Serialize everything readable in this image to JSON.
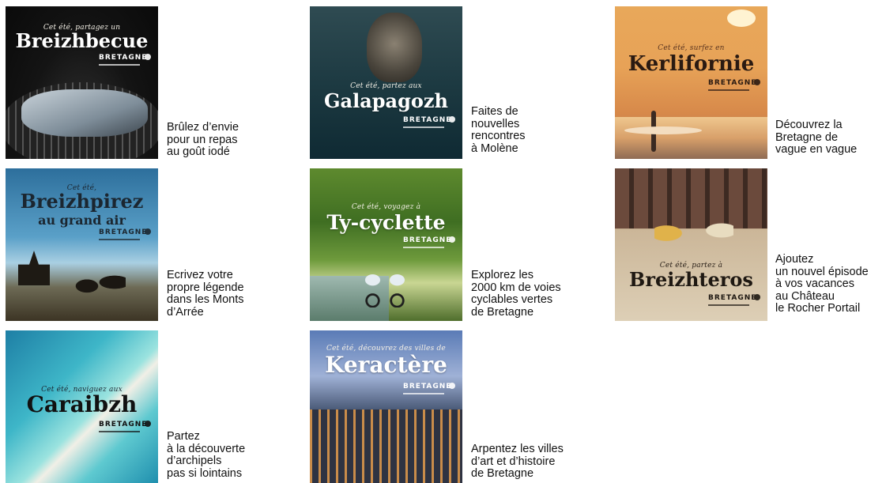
{
  "logo_text": "BRETAGNE",
  "posters": [
    {
      "intro": "Cet été, partagez un",
      "title": "Breizhbecue",
      "sub": "",
      "caption": "Brûlez d’envie\npour un repas\nau goût iodé"
    },
    {
      "intro": "Cet été, partez aux",
      "title": "Galapagozh",
      "sub": "",
      "caption": "Faites de\nnouvelles\nrencontres\nà Molène"
    },
    {
      "intro": "Cet été, surfez en",
      "title": "Kerlifornie",
      "sub": "",
      "caption": "Découvrez la\nBretagne de\nvague en vague"
    },
    {
      "intro": "Cet été,",
      "title": "Breizhpirez",
      "sub": "au grand air",
      "caption": "Ecrivez votre\npropre légende\ndans les Monts\nd’Arrée"
    },
    {
      "intro": "Cet été, voyagez à",
      "title": "Ty-cyclette",
      "sub": "",
      "caption": "Explorez les\n2000 km de voies\ncyclables vertes\nde Bretagne"
    },
    {
      "intro": "Cet été, partez à",
      "title": "Breizhteros",
      "sub": "",
      "caption": "Ajoutez\nun nouvel épisode\nà vos vacances\nau Château\nle Rocher Portail"
    },
    {
      "intro": "Cet été, naviguez aux",
      "title": "Caraibzh",
      "sub": "",
      "caption": "Partez\nà la découverte\nd’archipels\npas si lointains"
    },
    {
      "intro": "Cet été, découvrez des villes de",
      "title": "Keractère",
      "sub": "",
      "caption": "Arpentez les villes\nd’art et d’histoire\nde Bretagne"
    }
  ]
}
